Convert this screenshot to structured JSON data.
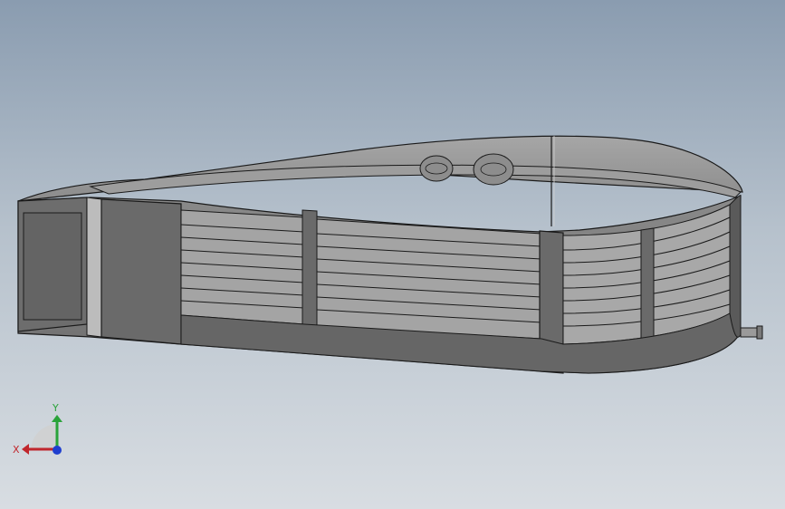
{
  "viewport": {
    "background_top": "#8a9cb0",
    "background_bottom": "#d8dde2"
  },
  "model": {
    "body_color": "#7c7c7c",
    "dark_color": "#5e5e5e",
    "light_color": "#a9a9a9",
    "edge_color": "#1a1a1a"
  },
  "triad": {
    "x_label": "X",
    "y_label": "Y",
    "x_color": "#c0262c",
    "y_color": "#2aa33a",
    "z_color": "#1f3fcf"
  }
}
